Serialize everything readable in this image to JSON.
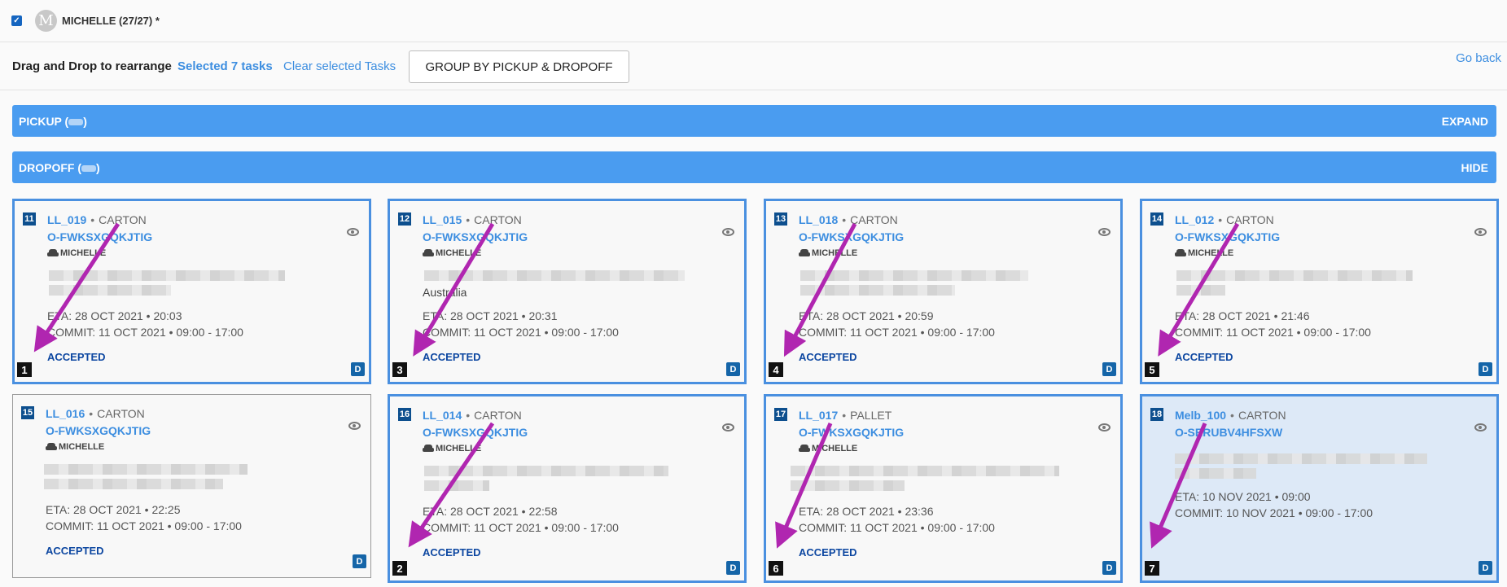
{
  "user": {
    "avatar_letter": "M",
    "name": "MICHELLE (27/27)",
    "dirty_marker": "*",
    "checked": true
  },
  "toolbar": {
    "instruction": "Drag and Drop to rearrange",
    "selected_label": "Selected 7 tasks",
    "clear_label": "Clear selected Tasks",
    "group_button": "GROUP BY PICKUP & DROPOFF",
    "go_back": "Go back"
  },
  "sections": {
    "pickup": {
      "label": "PICKUP (",
      "label_end": ")",
      "action": "EXPAND"
    },
    "dropoff": {
      "label": "DROPOFF (",
      "label_end": ")",
      "action": "HIDE"
    }
  },
  "cards": [
    {
      "seq": "11",
      "code": "LL_019",
      "type": "CARTON",
      "order": "O-FWKSXGQKJTIG",
      "driver": "MICHELLE",
      "address_visible": "",
      "eta": "ETA: 28 OCT 2021 • 20:03",
      "commit": "COMMIT: 11 OCT 2021 • 09:00 - 17:00",
      "status": "ACCEPTED",
      "badge": "D",
      "drop_order": "1"
    },
    {
      "seq": "12",
      "code": "LL_015",
      "type": "CARTON",
      "order": "O-FWKSXGQKJTIG",
      "driver": "MICHELLE",
      "address_visible": "Australia",
      "eta": "ETA: 28 OCT 2021 • 20:31",
      "commit": "COMMIT: 11 OCT 2021 • 09:00 - 17:00",
      "status": "ACCEPTED",
      "badge": "D",
      "drop_order": "3"
    },
    {
      "seq": "13",
      "code": "LL_018",
      "type": "CARTON",
      "order": "O-FWKSXGQKJTIG",
      "driver": "MICHELLE",
      "address_visible": "",
      "eta": "ETA: 28 OCT 2021 • 20:59",
      "commit": "COMMIT: 11 OCT 2021 • 09:00 - 17:00",
      "status": "ACCEPTED",
      "badge": "D",
      "drop_order": "4"
    },
    {
      "seq": "14",
      "code": "LL_012",
      "type": "CARTON",
      "order": "O-FWKSXGQKJTIG",
      "driver": "MICHELLE",
      "address_visible": "",
      "eta": "ETA: 28 OCT 2021 • 21:46",
      "commit": "COMMIT: 11 OCT 2021 • 09:00 - 17:00",
      "status": "ACCEPTED",
      "badge": "D",
      "drop_order": "5"
    },
    {
      "seq": "15",
      "code": "LL_016",
      "type": "CARTON",
      "order": "O-FWKSXGQKJTIG",
      "driver": "MICHELLE",
      "address_visible": "",
      "eta": "ETA: 28 OCT 2021 • 22:25",
      "commit": "COMMIT: 11 OCT 2021 • 09:00 - 17:00",
      "status": "ACCEPTED",
      "badge": "D",
      "drop_order": ""
    },
    {
      "seq": "16",
      "code": "LL_014",
      "type": "CARTON",
      "order": "O-FWKSXGQKJTIG",
      "driver": "MICHELLE",
      "address_visible": "",
      "eta": "ETA: 28 OCT 2021 • 22:58",
      "commit": "COMMIT: 11 OCT 2021 • 09:00 - 17:00",
      "status": "ACCEPTED",
      "badge": "D",
      "drop_order": "2"
    },
    {
      "seq": "17",
      "code": "LL_017",
      "type": "PALLET",
      "order": "O-FWKSXGQKJTIG",
      "driver": "MICHELLE",
      "address_visible": "",
      "eta": "ETA: 28 OCT 2021 • 23:36",
      "commit": "COMMIT: 11 OCT 2021 • 09:00 - 17:00",
      "status": "ACCEPTED",
      "badge": "D",
      "drop_order": "6"
    },
    {
      "seq": "18",
      "code": "Melb_100",
      "type": "CARTON",
      "order": "O-SERUBV4HFSXW",
      "driver": "",
      "address_visible": "",
      "eta": "ETA: 10 NOV 2021 • 09:00",
      "commit": "COMMIT: 10 NOV 2021 • 09:00 - 17:00",
      "status": "",
      "badge": "D",
      "drop_order": "7"
    }
  ],
  "colors": {
    "accent": "#4a9cf0",
    "link": "#3d8ee0",
    "status": "#0d47a1",
    "arrow": "#b026b0"
  }
}
